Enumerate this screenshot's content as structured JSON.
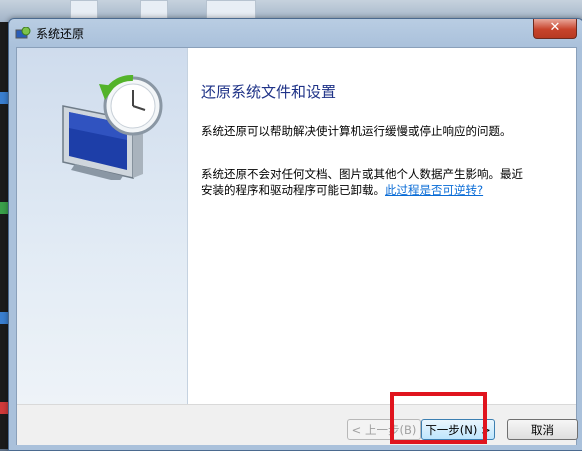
{
  "window": {
    "title": "系统还原",
    "close_label": "✕"
  },
  "content": {
    "heading": "还原系统文件和设置",
    "paragraph1": "系统还原可以帮助解决使计算机运行缓慢或停止响应的问题。",
    "paragraph2_line1": "系统还原不会对任何文档、图片或其他个人数据产生影响。最近",
    "paragraph2_line2": "安装的程序和驱动程序可能已卸载。",
    "link_text": "此过程是否可逆转?"
  },
  "footer": {
    "back_label": "< 上一步(B)",
    "next_label": "下一步(N) >",
    "cancel_label": "取消"
  },
  "colors": {
    "heading": "#1e3287",
    "link": "#0a6cd6",
    "highlight": "#e0141e"
  }
}
